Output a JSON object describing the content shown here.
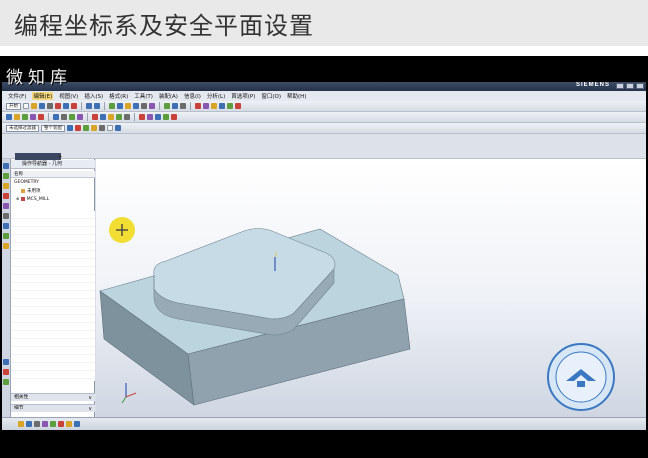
{
  "slide": {
    "title": "编程坐标系及安全平面设置"
  },
  "video": {
    "watermark": "微知库"
  },
  "app": {
    "brand": "SIEMENS",
    "menu": [
      "文件(F)",
      "编辑(E)",
      "视图(V)",
      "插入(S)",
      "格式(R)",
      "工具(T)",
      "装配(A)",
      "信息(I)",
      "分析(L)",
      "首选项(P)",
      "窗口(O)",
      "帮助(H)"
    ],
    "menu_active_index": 1,
    "start_label": "开始",
    "selection_filter": "未选择过滤器",
    "selection_scope": "整个装配"
  },
  "navigator": {
    "title": "操作导航器 - 几何",
    "column_name": "名称",
    "tree": [
      "GEOMETRY",
      "未用项",
      "MCS_MILL"
    ],
    "dependencies_label": "相关性",
    "details_label": "细节"
  },
  "colors": {
    "accent_cursor": "#f1d80f",
    "model_top": "#bcd4de",
    "model_side": "#7f929d"
  },
  "icons": [
    "minimize-icon",
    "maximize-icon",
    "close-icon",
    "crosshair-icon",
    "wcs-triad-icon",
    "emblem-icon"
  ]
}
